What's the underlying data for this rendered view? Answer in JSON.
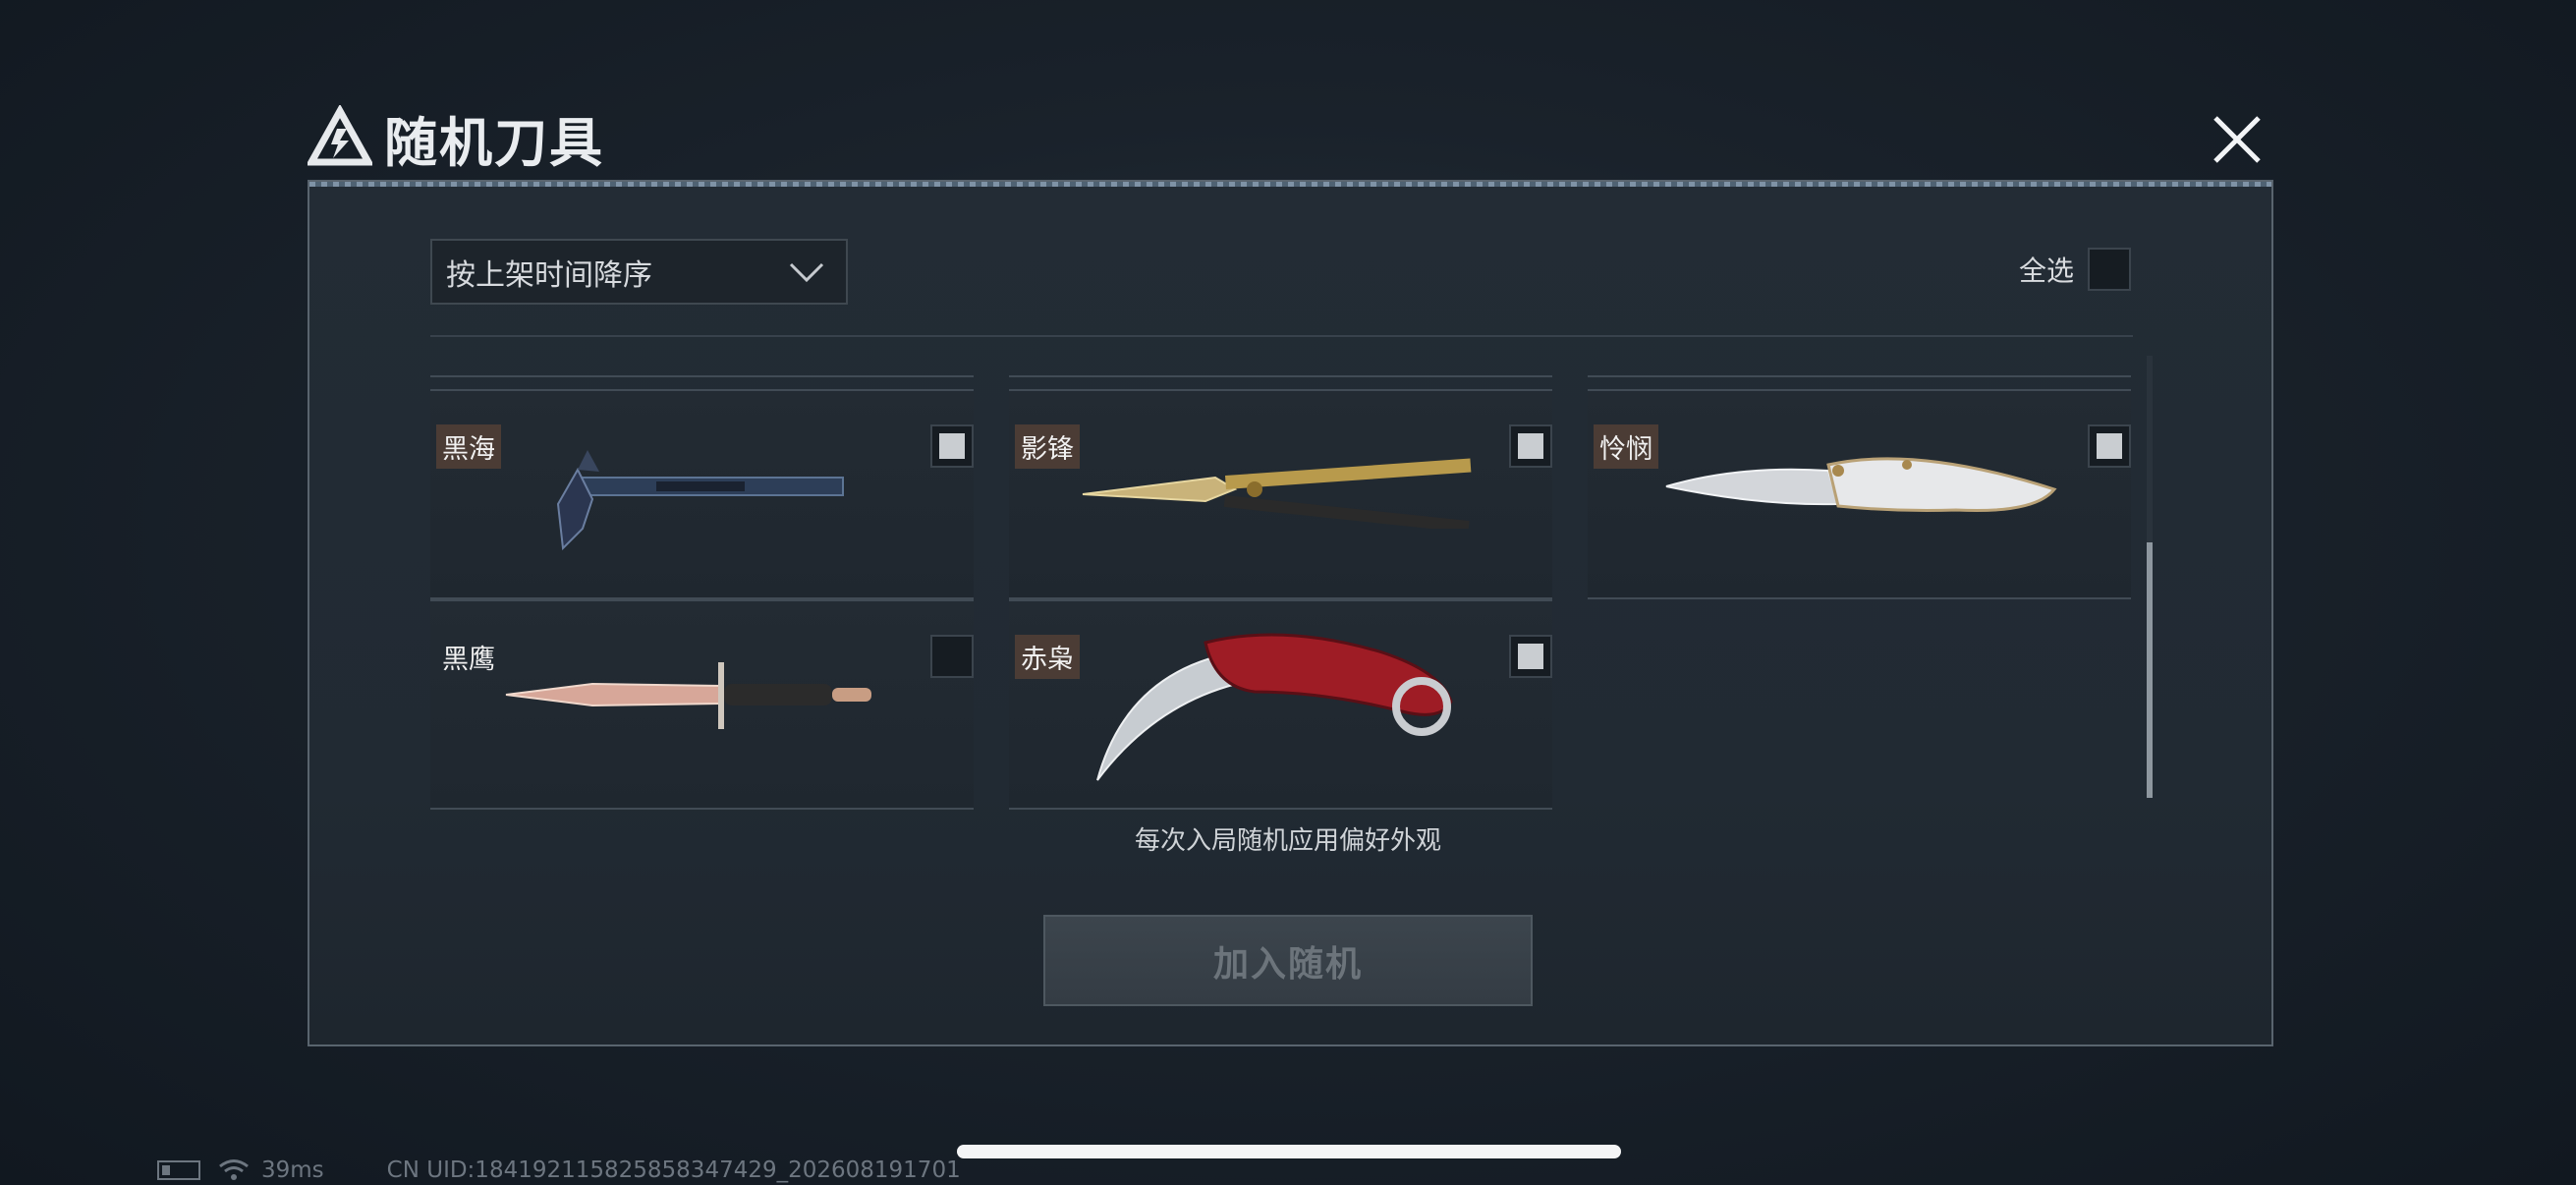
{
  "dialog": {
    "title": "随机刀具",
    "close_icon": "close-icon"
  },
  "toolbar": {
    "sort_value": "按上架时间降序",
    "select_all_label": "全选"
  },
  "items": [
    {
      "name": "黑海",
      "checked": true
    },
    {
      "name": "影锋",
      "checked": true
    },
    {
      "name": "怜悯",
      "checked": true
    },
    {
      "name": "黑鹰",
      "checked": false
    },
    {
      "name": "赤枭",
      "checked": true
    }
  ],
  "hint": "每次入局随机应用偏好外观",
  "add_button_label": "加入随机",
  "status_bar": {
    "ping": "39ms",
    "uid": "CN UID:184192115825858347429_202608191701"
  }
}
